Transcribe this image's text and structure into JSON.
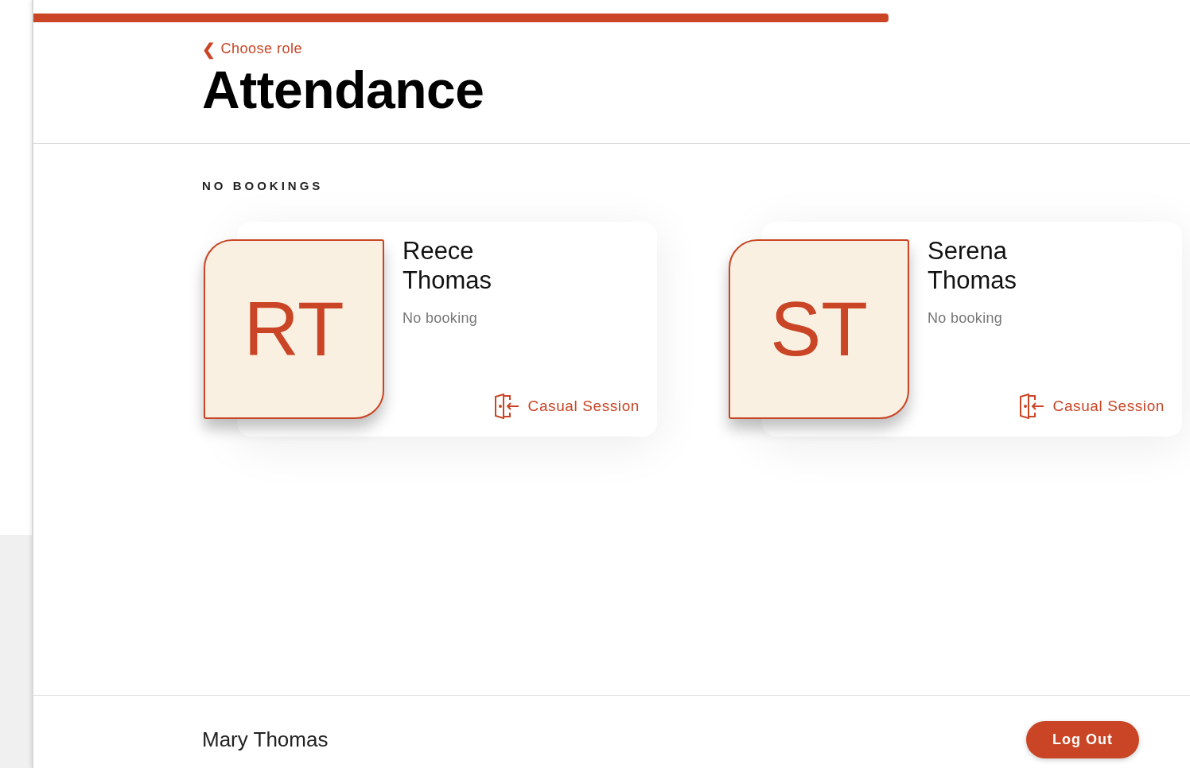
{
  "progress": {
    "level": 0.739
  },
  "back_link": {
    "icon": "❮",
    "label": "Choose role"
  },
  "title": "Attendance",
  "section": {
    "heading": "NO BOOKINGS",
    "people": [
      {
        "initials": "RT",
        "name": "Reece Thomas",
        "status": "No booking",
        "action": "Casual Session"
      },
      {
        "initials": "ST",
        "name": "Serena Thomas",
        "status": "No booking",
        "action": "Casual Session"
      }
    ]
  },
  "footer": {
    "user": "Mary Thomas",
    "button": "Log Out"
  }
}
